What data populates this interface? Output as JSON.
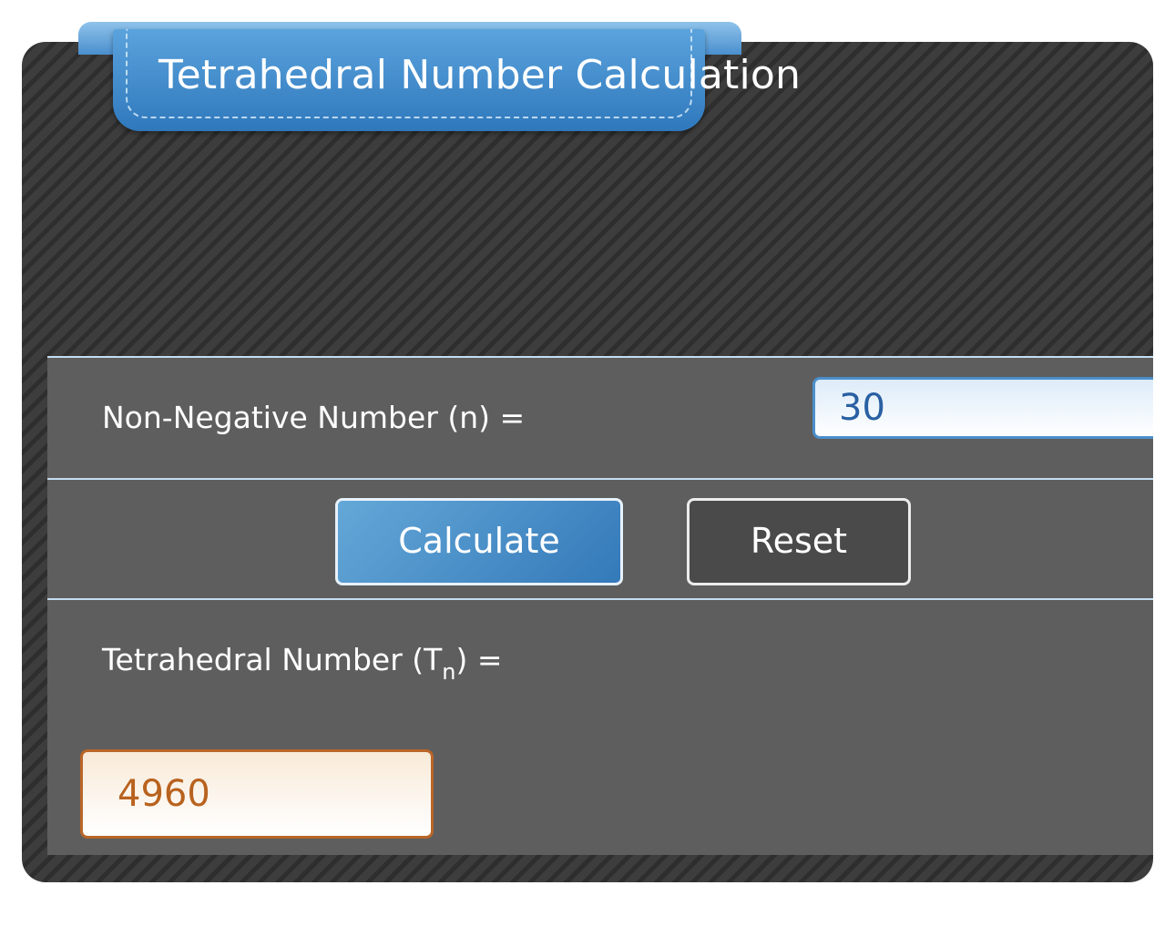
{
  "title": "Tetrahedral Number Calculation",
  "form": {
    "input_label": "Non-Negative Number (n) =",
    "input_value": "30",
    "calculate_label": "Calculate",
    "reset_label": "Reset",
    "result_label_prefix": "Tetrahedral Number (T",
    "result_label_sub": "n",
    "result_label_suffix": ") =",
    "result_value": "4960"
  },
  "colors": {
    "accent_blue": "#3479b9",
    "result_orange": "#b8621e",
    "panel_dark": "#3a3a3a"
  }
}
